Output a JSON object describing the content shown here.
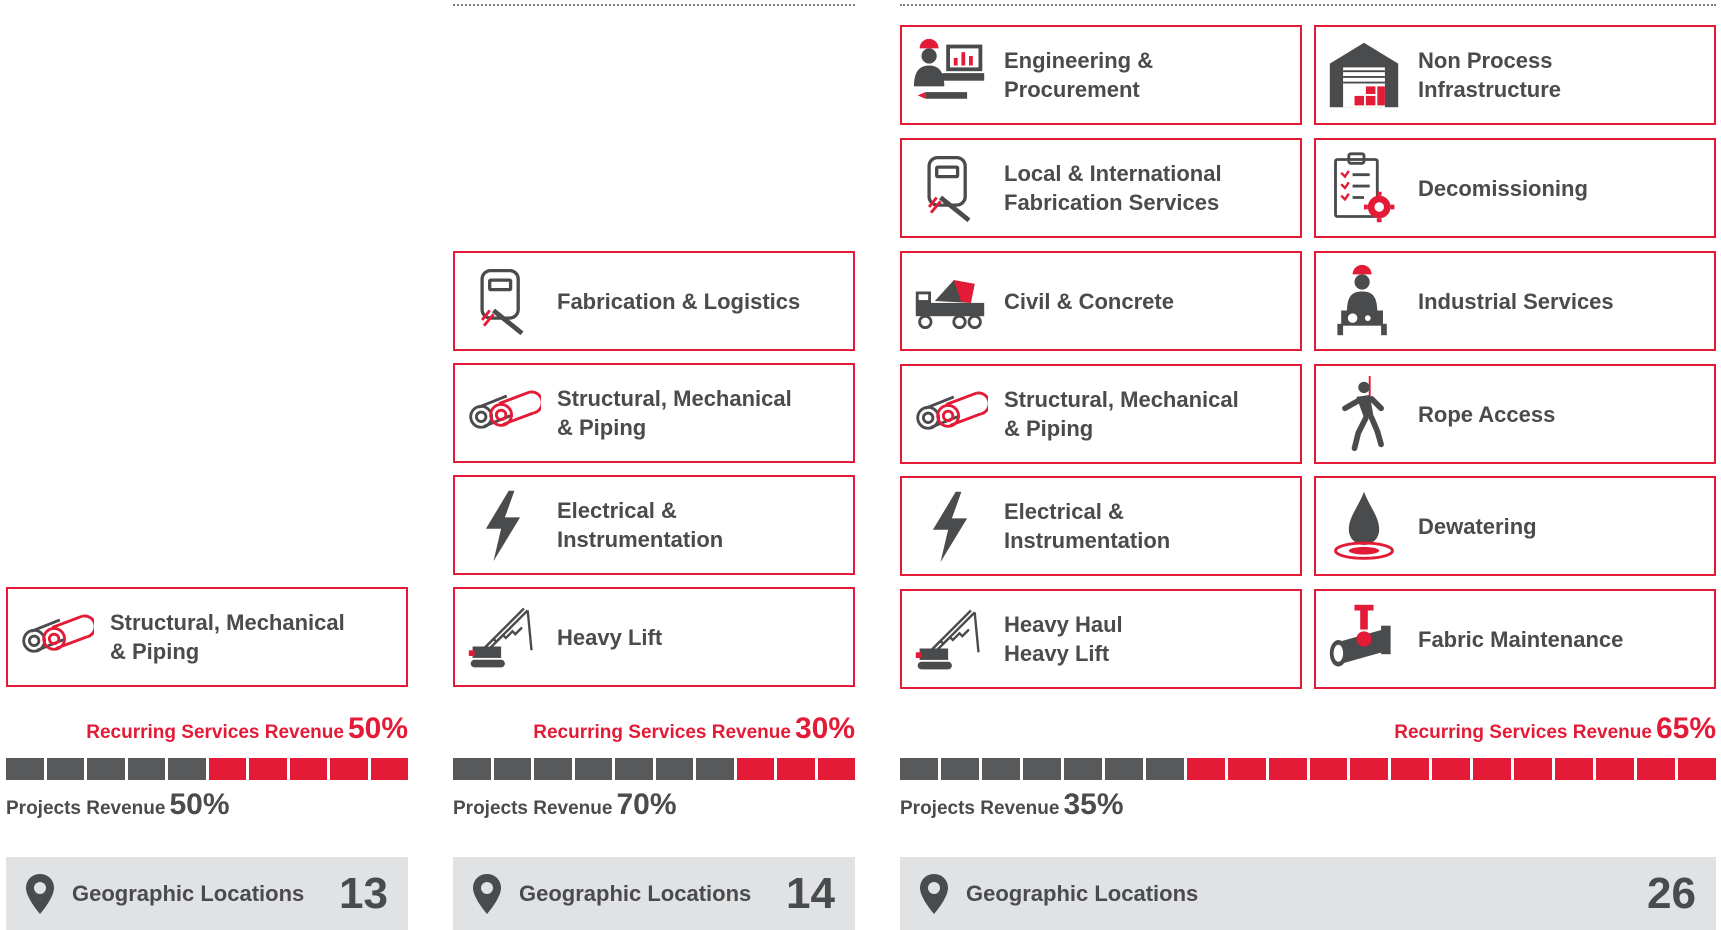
{
  "colors": {
    "accent": "#e31b37",
    "dark": "#58595b",
    "text": "#4a4b4d",
    "panel": "#e1e2e3"
  },
  "columns": [
    {
      "cards": [
        {
          "label": "Structural, Mechanical\n& Piping",
          "icon": "pipes-icon"
        }
      ],
      "recurring_label": "Recurring Services Revenue",
      "recurring_pct": "50%",
      "recurring_fraction": 0.5,
      "projects_label": "Projects Revenue",
      "projects_pct": "50%",
      "geo_label": "Geographic Locations",
      "geo_count": "13"
    },
    {
      "cards": [
        {
          "label": "Fabrication & Logistics",
          "icon": "welding-mask-icon"
        },
        {
          "label": "Structural, Mechanical\n& Piping",
          "icon": "pipes-icon"
        },
        {
          "label": "Electrical &\nInstrumentation",
          "icon": "lightning-icon"
        },
        {
          "label": "Heavy Lift",
          "icon": "crane-icon"
        }
      ],
      "recurring_label": "Recurring Services Revenue",
      "recurring_pct": "30%",
      "recurring_fraction": 0.3,
      "projects_label": "Projects Revenue",
      "projects_pct": "70%",
      "geo_label": "Geographic Locations",
      "geo_count": "14"
    },
    {
      "cards": [
        {
          "label": "Engineering &\nProcurement",
          "icon": "engineer-computer-icon"
        },
        {
          "label": "Non Process\nInfrastructure",
          "icon": "warehouse-icon"
        },
        {
          "label": "Local & International\nFabrication Services",
          "icon": "welding-mask-icon"
        },
        {
          "label": "Decomissioning",
          "icon": "clipboard-gear-icon"
        },
        {
          "label": "Civil & Concrete",
          "icon": "concrete-mixer-icon"
        },
        {
          "label": "Industrial Services",
          "icon": "industrial-worker-icon"
        },
        {
          "label": "Structural, Mechanical\n& Piping",
          "icon": "pipes-icon"
        },
        {
          "label": "Rope Access",
          "icon": "rope-climber-icon"
        },
        {
          "label": "Electrical &\nInstrumentation",
          "icon": "lightning-icon"
        },
        {
          "label": "Dewatering",
          "icon": "water-drop-icon"
        },
        {
          "label": "Heavy Haul\nHeavy Lift",
          "icon": "crane-icon"
        },
        {
          "label": "Fabric Maintenance",
          "icon": "pipe-valve-icon"
        }
      ],
      "recurring_label": "Recurring Services Revenue",
      "recurring_pct": "65%",
      "recurring_fraction": 0.65,
      "projects_label": "Projects Revenue",
      "projects_pct": "35%",
      "geo_label": "Geographic Locations",
      "geo_count": "26"
    }
  ]
}
